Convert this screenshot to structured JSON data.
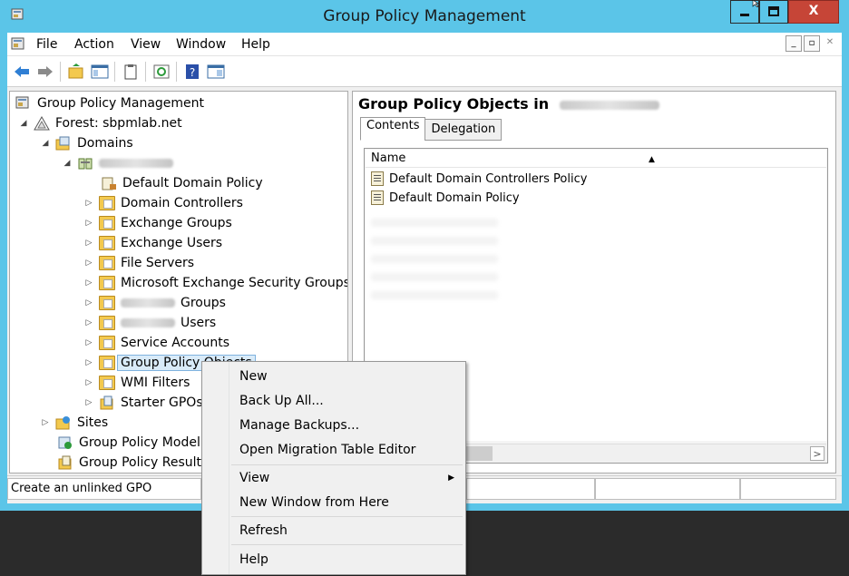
{
  "window": {
    "title": "Group Policy Management",
    "close_label": "X"
  },
  "menubar": {
    "items": [
      "File",
      "Action",
      "View",
      "Window",
      "Help"
    ]
  },
  "tree": {
    "root": "Group Policy Management",
    "forest": "Forest: sbpmlab.net",
    "domains": "Domains",
    "items": {
      "default_domain_policy": "Default Domain Policy",
      "domain_controllers": "Domain Controllers",
      "exchange_groups": "Exchange Groups",
      "exchange_users": "Exchange Users",
      "file_servers": "File Servers",
      "ms_exchange_security_groups": "Microsoft Exchange Security Groups",
      "groups_suffix": "Groups",
      "users_suffix": "Users",
      "service_accounts": "Service Accounts",
      "group_policy_objects": "Group Policy Objects",
      "wmi_filters": "WMI Filters",
      "starter_gpos": "Starter GPOs"
    },
    "sites": "Sites",
    "modeling": "Group Policy Modeling",
    "results": "Group Policy Results"
  },
  "right_pane": {
    "title": "Group Policy Objects in",
    "tabs": [
      "Contents",
      "Delegation"
    ],
    "column_name": "Name",
    "rows": [
      "Default Domain Controllers Policy",
      "Default Domain Policy"
    ]
  },
  "status": {
    "text": "Create an unlinked GPO"
  },
  "context_menu": {
    "new": "New",
    "backup_all": "Back Up All...",
    "manage_backups": "Manage Backups...",
    "open_migration": "Open Migration Table Editor",
    "view": "View",
    "new_window": "New Window from Here",
    "refresh": "Refresh",
    "help": "Help"
  },
  "colors": {
    "titlebar": "#5bc5e8",
    "close_button": "#c64537",
    "selection": "#d9ebf9"
  }
}
